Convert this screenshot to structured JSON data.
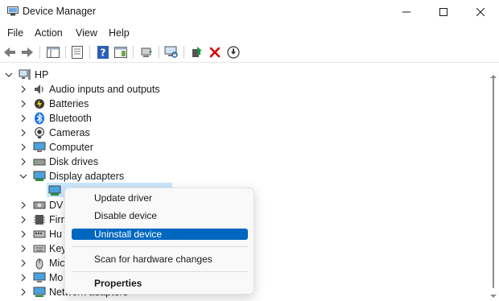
{
  "window": {
    "title": "Device Manager"
  },
  "menu": [
    "File",
    "Action",
    "View",
    "Help"
  ],
  "tree": {
    "root": "HP",
    "categories": [
      {
        "label": "Audio inputs and outputs",
        "icon": "speaker-icon",
        "expanded": false
      },
      {
        "label": "Batteries",
        "icon": "battery-icon",
        "expanded": false
      },
      {
        "label": "Bluetooth",
        "icon": "bluetooth-icon",
        "expanded": false
      },
      {
        "label": "Cameras",
        "icon": "camera-icon",
        "expanded": false
      },
      {
        "label": "Computer",
        "icon": "computer-icon",
        "expanded": false
      },
      {
        "label": "Disk drives",
        "icon": "disk-drive-icon",
        "expanded": false
      },
      {
        "label": "Display adapters",
        "icon": "display-adapter-icon",
        "expanded": true
      },
      {
        "label": "DV",
        "icon": "dvd-drive-icon",
        "expanded": false
      },
      {
        "label": "Firm",
        "icon": "firmware-icon",
        "expanded": false
      },
      {
        "label": "Hu",
        "icon": "hid-icon",
        "expanded": false
      },
      {
        "label": "Key",
        "icon": "keyboard-icon",
        "expanded": false
      },
      {
        "label": "Mic",
        "icon": "mouse-icon",
        "expanded": false
      },
      {
        "label": "Mo",
        "icon": "monitor-icon",
        "expanded": false
      },
      {
        "label": "Network adapters",
        "icon": "network-adapter-icon",
        "expanded": false
      }
    ]
  },
  "context_menu": {
    "items": [
      {
        "label": "Update driver"
      },
      {
        "label": "Disable device"
      },
      {
        "label": "Uninstall device"
      },
      {
        "label": "Scan for hardware changes"
      },
      {
        "label": "Properties"
      }
    ],
    "highlighted": "Uninstall device"
  },
  "colors": {
    "selection_bg": "#cce8ff",
    "menu_active": "#0067c0",
    "uninstall_red": "#d40000",
    "update_green": "#1a9c3e"
  }
}
